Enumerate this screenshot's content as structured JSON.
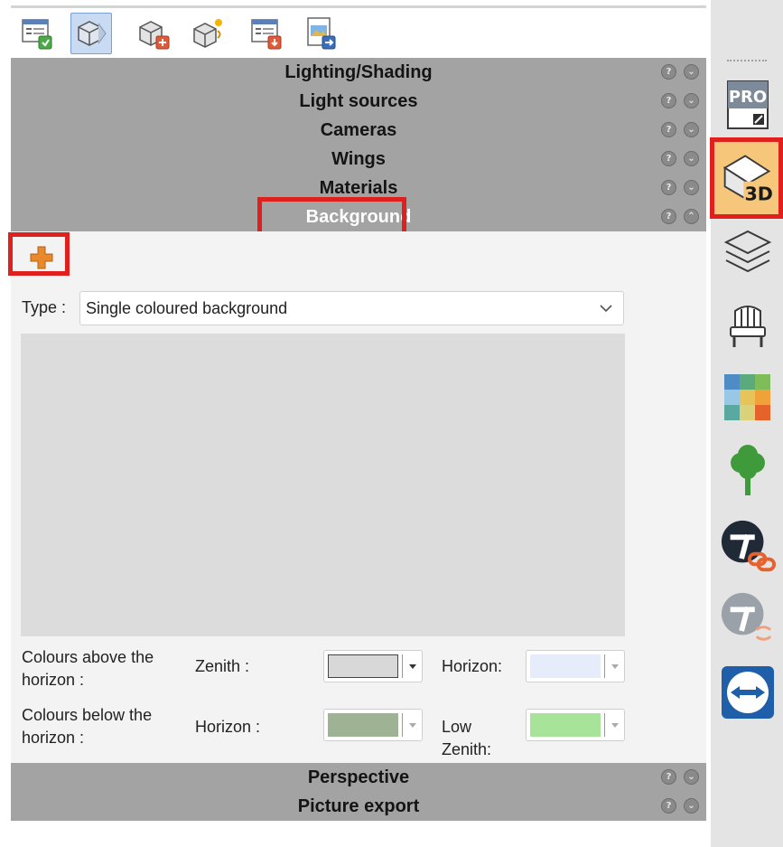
{
  "toolbar": {
    "buttons": [
      {
        "icon": "render-settings-icon"
      },
      {
        "icon": "3d-view-icon",
        "active": true
      },
      {
        "icon": "3d-export-icon"
      },
      {
        "icon": "lighting-icon"
      },
      {
        "icon": "document-save-icon"
      },
      {
        "icon": "picture-export-icon"
      }
    ]
  },
  "sections_top": [
    {
      "label": "Lighting/Shading"
    },
    {
      "label": "Light sources"
    },
    {
      "label": "Cameras"
    },
    {
      "label": "Wings"
    },
    {
      "label": "Materials"
    },
    {
      "label": "Background",
      "expanded": true
    }
  ],
  "panel": {
    "add_icon": "add-icon",
    "type_label": "Type :",
    "type_value": "Single coloured background",
    "above": {
      "label_line1": "Colours above the",
      "label_line2": "horizon :",
      "zenith_label": "Zenith :",
      "horizon_label": "Horizon:",
      "zenith_color": "#d8d8d8",
      "horizon_color": "#e6ecfa"
    },
    "below": {
      "label_line1": "Colours below the",
      "label_line2": "horizon :",
      "horizon_label": "Horizon :",
      "low_zenith_label_line1": "Low",
      "low_zenith_label_line2": "Zenith:",
      "horizon_color": "#9db394",
      "low_zenith_color": "#a8e39a"
    }
  },
  "sections_bottom": [
    {
      "label": "Perspective"
    },
    {
      "label": "Picture export"
    }
  ],
  "section_controls": {
    "help": "?",
    "collapse": "⌄"
  },
  "sidebar": {
    "items": [
      {
        "icon": "pro-icon",
        "text": "PRO"
      },
      {
        "icon": "3d-icon",
        "text": "3D",
        "active": true
      },
      {
        "icon": "layers-icon"
      },
      {
        "icon": "chair-icon"
      },
      {
        "icon": "materials-palette-icon"
      },
      {
        "icon": "tree-icon"
      },
      {
        "icon": "link-icon"
      },
      {
        "icon": "sync-icon"
      },
      {
        "icon": "teamviewer-icon"
      }
    ]
  },
  "colors": {
    "highlight": "#e0201c",
    "section_bg": "#a3a3a3",
    "active_bg": "#f6c77a"
  }
}
